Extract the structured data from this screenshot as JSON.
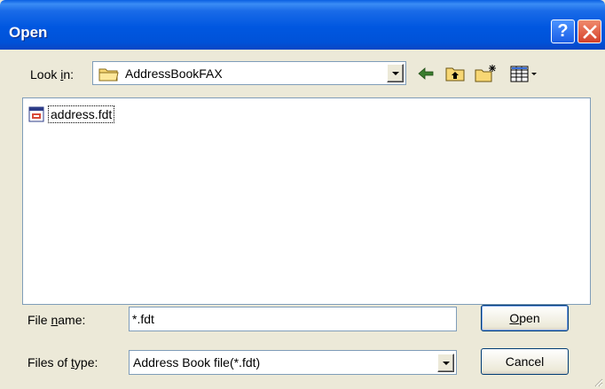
{
  "window": {
    "title": "Open",
    "help_glyph": "?",
    "controls": [
      "help-icon",
      "close-icon"
    ]
  },
  "lookin": {
    "label_pre": "Look ",
    "label_accel": "i",
    "label_post": "n:",
    "value": "AddressBookFAX",
    "icon": "folder-icon"
  },
  "toolbar": {
    "icons": [
      "back-arrow-icon",
      "up-folder-icon",
      "new-folder-icon",
      "views-menu-icon"
    ]
  },
  "files": [
    {
      "name": "address.fdt",
      "icon": "fdt-file-icon"
    }
  ],
  "filename": {
    "label_pre": "File ",
    "label_accel": "n",
    "label_post": "ame:",
    "value": "*.fdt"
  },
  "filetype": {
    "label_pre": "Files of ",
    "label_accel": "t",
    "label_post": "ype:",
    "value": "Address Book file(*.fdt)"
  },
  "buttons": {
    "open_accel": "O",
    "open_rest": "pen",
    "cancel": "Cancel"
  },
  "colors": {
    "titlebar": "#0054e3",
    "close": "#d5412a",
    "dialog_bg": "#ece9d8",
    "border": "#7f9db9"
  }
}
